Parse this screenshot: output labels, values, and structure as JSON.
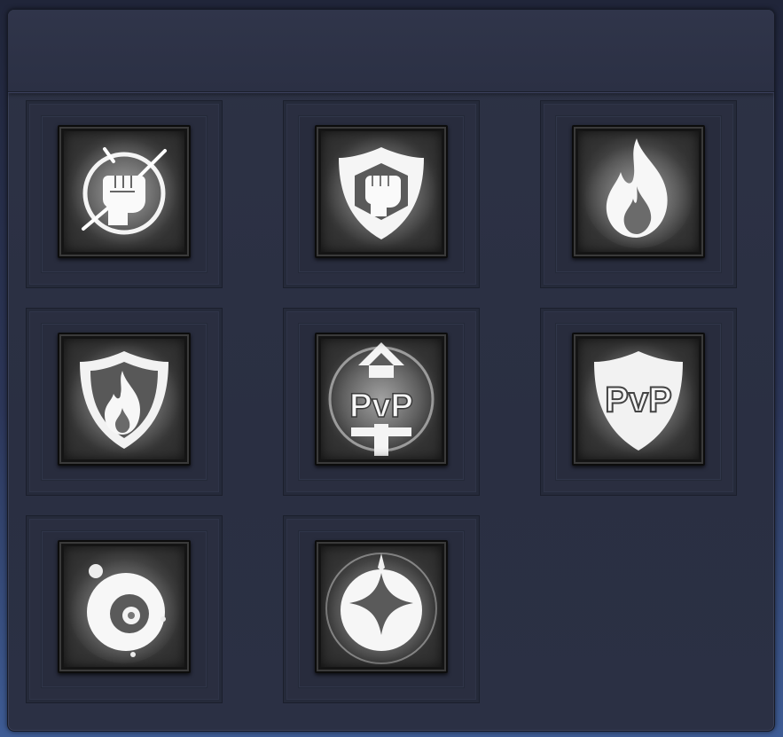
{
  "window": {
    "title": ""
  },
  "slots": [
    {
      "icon": "fist-burst-icon",
      "text": ""
    },
    {
      "icon": "fist-shield-icon",
      "text": ""
    },
    {
      "icon": "flame-icon",
      "text": ""
    },
    {
      "icon": "flame-shield-icon",
      "text": ""
    },
    {
      "icon": "pvp-sword-icon",
      "text": "PvP"
    },
    {
      "icon": "pvp-shield-icon",
      "text": "PvP"
    },
    {
      "icon": "orb-ring-icon",
      "text": ""
    },
    {
      "icon": "star-orb-icon",
      "text": ""
    }
  ]
}
